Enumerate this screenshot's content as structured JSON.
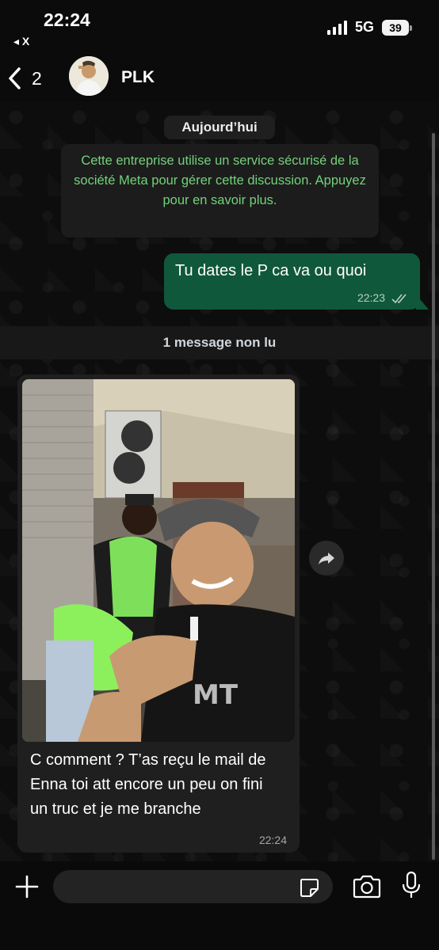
{
  "status_bar": {
    "time": "22:24",
    "back_label": "◂ X",
    "network": "5G",
    "battery": "39"
  },
  "header": {
    "back_count": "2",
    "contact_name": "PLK"
  },
  "chat": {
    "date_chip": "Aujourd’hui",
    "system_message": "Cette entreprise utilise un service sécurisé de la société Meta pour gérer cette discussion. Appuyez pour en savoir plus.",
    "outgoing": {
      "text": "Tu dates le P ca va ou quoi",
      "time": "22:23"
    },
    "unread_label": "1 message non lu",
    "incoming": {
      "text": "C comment ? T’as reçu le mail de Enna toi att encore un peu on fini un truc et je me branche",
      "time": "22:24"
    }
  },
  "composer": {
    "placeholder": ""
  },
  "colors": {
    "outgoing_bubble": "#10583b",
    "incoming_bubble": "#1f1f1f",
    "system_text": "#72d27b",
    "background": "#0b0b0b"
  }
}
